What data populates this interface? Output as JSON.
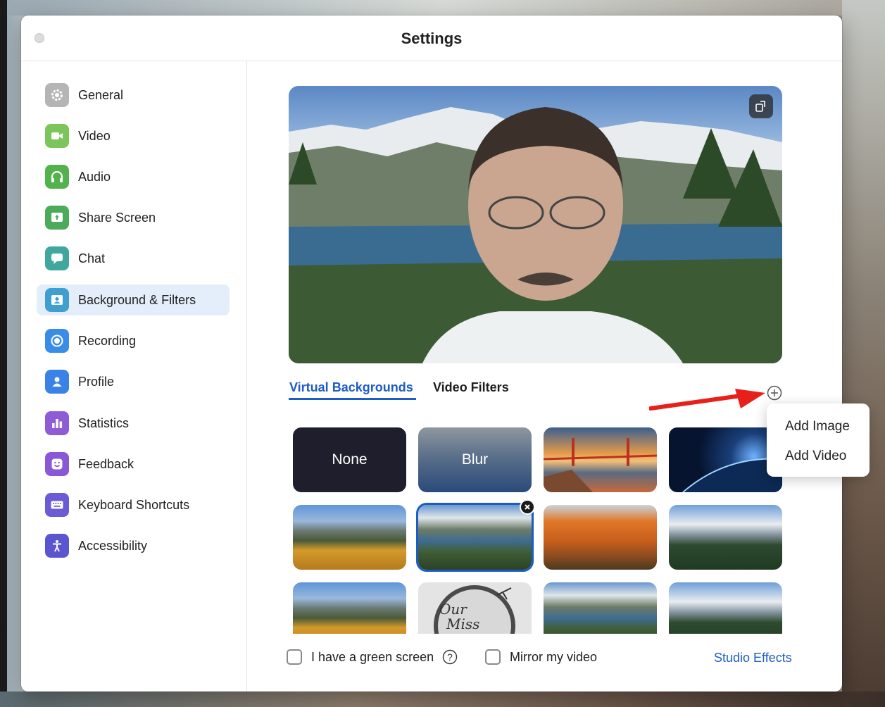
{
  "window": {
    "title": "Settings"
  },
  "sidebar": {
    "items": [
      {
        "label": "General",
        "icon": "gear-icon",
        "color": "#b5b5b5"
      },
      {
        "label": "Video",
        "icon": "video-camera-icon",
        "color": "#7cc55a"
      },
      {
        "label": "Audio",
        "icon": "headphones-icon",
        "color": "#52b24b"
      },
      {
        "label": "Share Screen",
        "icon": "share-screen-icon",
        "color": "#4caa5b"
      },
      {
        "label": "Chat",
        "icon": "chat-bubble-icon",
        "color": "#3fa79e"
      },
      {
        "label": "Background & Filters",
        "icon": "person-frame-icon",
        "color": "#3fa0d0",
        "active": true
      },
      {
        "label": "Recording",
        "icon": "record-icon",
        "color": "#3a8de6"
      },
      {
        "label": "Profile",
        "icon": "profile-icon",
        "color": "#3a82e6"
      },
      {
        "label": "Statistics",
        "icon": "bar-chart-icon",
        "color": "#8e5cd6"
      },
      {
        "label": "Feedback",
        "icon": "smiley-icon",
        "color": "#8a58d6"
      },
      {
        "label": "Keyboard Shortcuts",
        "icon": "keyboard-icon",
        "color": "#6b5bd6"
      },
      {
        "label": "Accessibility",
        "icon": "accessibility-icon",
        "color": "#5a56d0"
      }
    ]
  },
  "tabs": {
    "virtual_backgrounds": "Virtual Backgrounds",
    "video_filters": "Video Filters"
  },
  "backgrounds": {
    "none_label": "None",
    "blur_label": "Blur",
    "tiles": [
      "None",
      "Blur",
      "golden-gate-bridge",
      "earth-from-space",
      "aspen-mountains",
      "lake-mountains",
      "orange-aspens",
      "snowy-peaks",
      "aspen-mountains-2",
      "our-miss-brooks",
      "lake-mountains-2",
      "snowy-peaks-2"
    ],
    "selected_index": 5
  },
  "add_menu": {
    "add_image": "Add Image",
    "add_video": "Add Video"
  },
  "options": {
    "green_screen": "I have a green screen",
    "mirror": "Mirror my video",
    "studio_effects": "Studio Effects"
  },
  "colors": {
    "accent": "#1d5cc4",
    "arrow": "#e8201a"
  }
}
